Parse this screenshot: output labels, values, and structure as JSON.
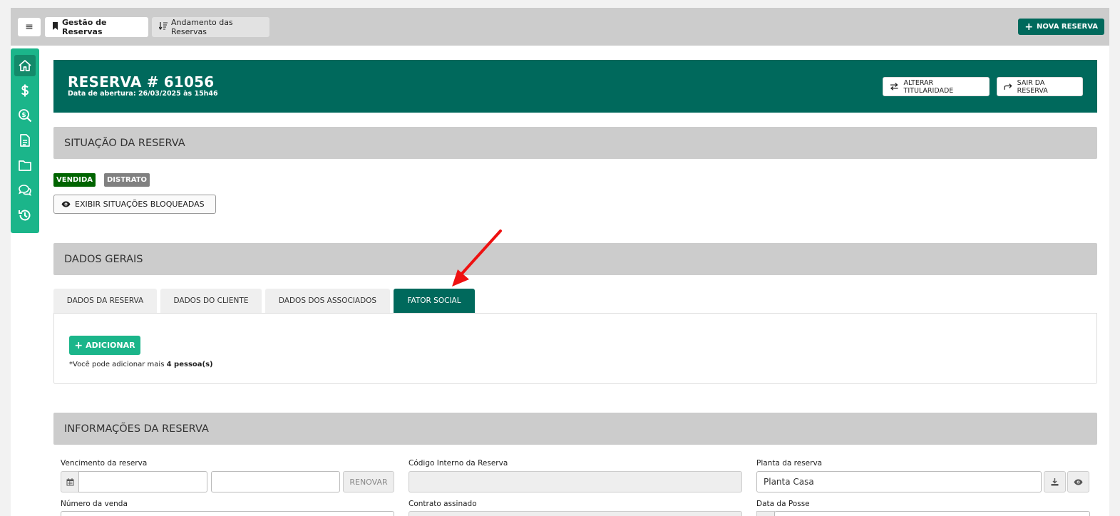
{
  "topbar": {
    "menu_icon": "≡",
    "tabs": [
      {
        "label": "Gestão de Reservas",
        "icon": "bookmark-icon",
        "active": true
      },
      {
        "label": "Andamento das Reservas",
        "icon": "sort-icon",
        "active": false
      }
    ],
    "nova_reserva_label": "NOVA RESERVA"
  },
  "sidebar": {
    "items": [
      {
        "icon": "home-icon",
        "active": true
      },
      {
        "icon": "dollar-icon",
        "active": false
      },
      {
        "icon": "search-money-icon",
        "active": false
      },
      {
        "icon": "document-icon",
        "active": false
      },
      {
        "icon": "folder-icon",
        "active": false
      },
      {
        "icon": "chat-icon",
        "active": false
      },
      {
        "icon": "history-icon",
        "active": false
      }
    ]
  },
  "header": {
    "title": "RESERVA # 61056",
    "subtitle": "Data de abertura: 26/03/2025 às 15h46",
    "alterar_label": "ALTERAR TITULARIDADE",
    "sair_label": "SAIR DA RESERVA",
    "accent": "#00695c"
  },
  "situacao": {
    "title": "SITUAÇÃO DA RESERVA",
    "badges": [
      {
        "label": "VENDIDA",
        "color": "#006400"
      },
      {
        "label": "DISTRATO",
        "color": "#808080"
      }
    ],
    "exibir_label": "EXIBIR SITUAÇÕES BLOQUEADAS"
  },
  "dados_gerais": {
    "title": "DADOS GERAIS",
    "tabs": [
      {
        "label": "DADOS DA RESERVA",
        "active": false
      },
      {
        "label": "DADOS DO CLIENTE",
        "active": false
      },
      {
        "label": "DADOS DOS ASSOCIADOS",
        "active": false
      },
      {
        "label": "FATOR SOCIAL",
        "active": true
      }
    ],
    "add_label": "ADICIONAR",
    "note_prefix": "*Você pode adicionar mais",
    "note_bold": "4 pessoa(s)"
  },
  "informacoes": {
    "title": "INFORMAÇÕES DA RESERVA",
    "vencimento_label": "Vencimento da reserva",
    "vencimento_value_1": "",
    "vencimento_value_2": "",
    "renovar_label": "RENOVAR",
    "codigo_label": "Código Interno da Reserva",
    "codigo_value": "",
    "planta_label": "Planta da reserva",
    "planta_value": "Planta Casa",
    "numero_venda_label": "Número da venda",
    "contrato_label": "Contrato assinado",
    "data_posse_label": "Data da Posse"
  }
}
